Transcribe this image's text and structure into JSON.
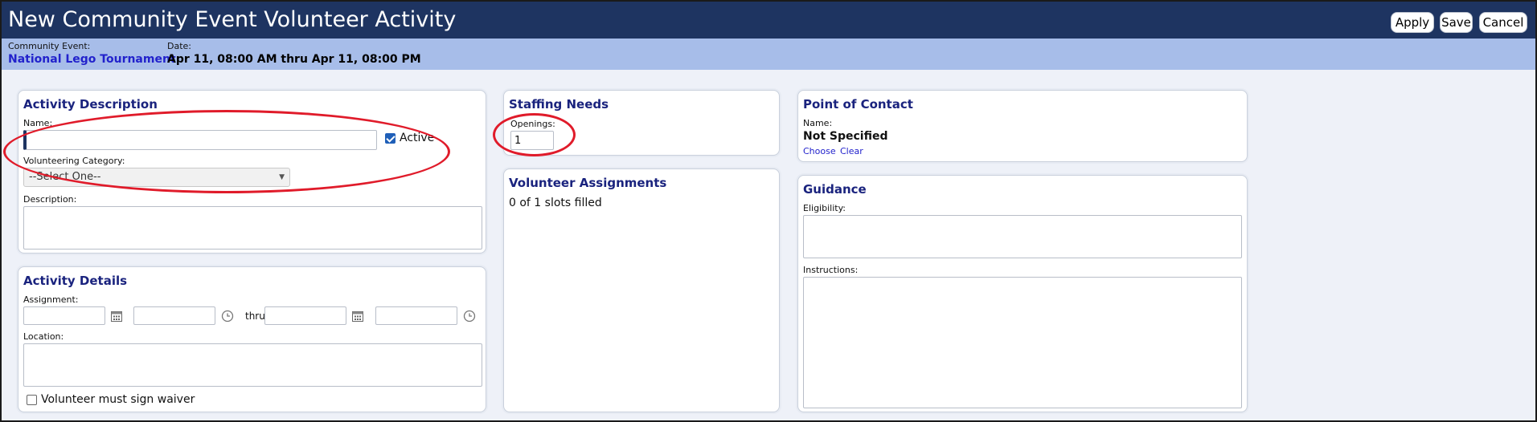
{
  "header": {
    "title": "New Community Event Volunteer Activity",
    "buttons": {
      "apply": "Apply",
      "save": "Save",
      "cancel": "Cancel"
    }
  },
  "event": {
    "event_label": "Community Event:",
    "event_name": "National Lego Tournament",
    "date_label": "Date:",
    "date_value": "Apr 11, 08:00 AM thru Apr 11, 08:00 PM"
  },
  "activity_description": {
    "title": "Activity Description",
    "name_label": "Name:",
    "name_value": "",
    "active_label": "Active",
    "active_checked": true,
    "category_label": "Volunteering Category:",
    "category_selected": "--Select One--",
    "description_label": "Description:",
    "description_value": ""
  },
  "activity_details": {
    "title": "Activity Details",
    "assignment_label": "Assignment:",
    "thru_label": "thru",
    "location_label": "Location:",
    "waiver_label": "Volunteer must sign waiver",
    "waiver_checked": false
  },
  "staffing_needs": {
    "title": "Staffing Needs",
    "openings_label": "Openings:",
    "openings_value": "1"
  },
  "volunteer_assignments": {
    "title": "Volunteer Assignments",
    "status": "0 of 1 slots filled"
  },
  "point_of_contact": {
    "title": "Point of Contact",
    "name_label": "Name:",
    "name_value": "Not Specified",
    "choose_link": "Choose",
    "clear_link": "Clear"
  },
  "guidance": {
    "title": "Guidance",
    "eligibility_label": "Eligibility:",
    "instructions_label": "Instructions:"
  },
  "colors": {
    "titlebar": "#1e3461",
    "infobar": "#a7bde9",
    "section_title": "#1a237e",
    "link": "#2222cc",
    "annotation": "#e01b2a"
  },
  "icons": [
    "calendar-icon",
    "clock-icon",
    "chevron-down-icon",
    "checkmark-icon"
  ]
}
